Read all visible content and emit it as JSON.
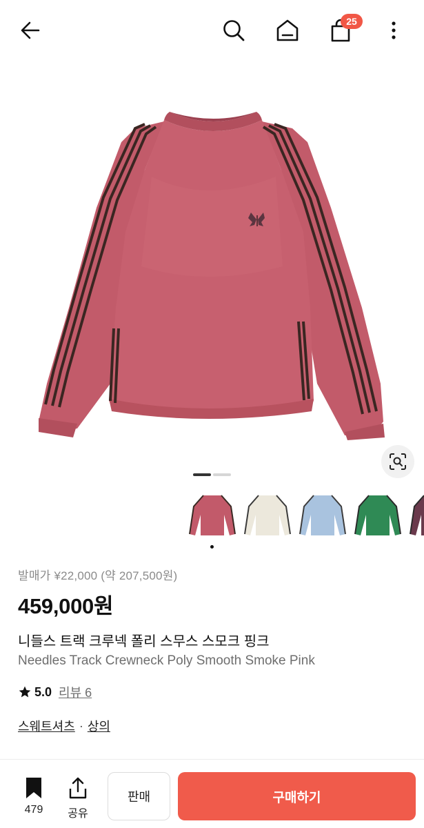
{
  "header": {
    "back_icon": "arrow-left-icon",
    "search_icon": "search-icon",
    "home_icon": "home-icon",
    "cart_icon": "shopping-bag-icon",
    "cart_count": "25",
    "more_icon": "more-vertical-icon"
  },
  "gallery": {
    "lens_icon": "visual-search-icon",
    "total_pages": 2,
    "current_page": 1,
    "thumbnails": [
      {
        "color": "#c25a6a",
        "stripe": "#3a2a24",
        "name": "smoke-pink"
      },
      {
        "color": "#ece8dc",
        "stripe": "#3b3b3b",
        "name": "ivory"
      },
      {
        "color": "#a9c3df",
        "stripe": "#3d3d3d",
        "name": "light-blue"
      },
      {
        "color": "#2f8a55",
        "stripe": "#2a2a2a",
        "name": "green"
      },
      {
        "color": "#6a3a4c",
        "stripe": "#2a2a2a",
        "name": "plum"
      }
    ],
    "selected_thumbnail": 0
  },
  "product": {
    "release_price": "발매가 ¥22,000 (약 207,500원)",
    "price": "459,000원",
    "title_ko": "니들스 트랙 크루넥 폴리 스무스 스모크 핑크",
    "title_en": "Needles Track Crewneck Poly Smooth Smoke Pink",
    "rating": "5.0",
    "reviews_label": "리뷰 6",
    "categories": [
      "스웨트셔츠",
      "상의"
    ],
    "category_separator": "·"
  },
  "bottom": {
    "bookmark_count": "479",
    "share_label": "공유",
    "sell_label": "판매",
    "buy_label": "구매하기"
  },
  "colors": {
    "accent": "#f05b4b",
    "badge": "#f15746",
    "sweater": "#c7606f",
    "stripe": "#3a2622"
  }
}
